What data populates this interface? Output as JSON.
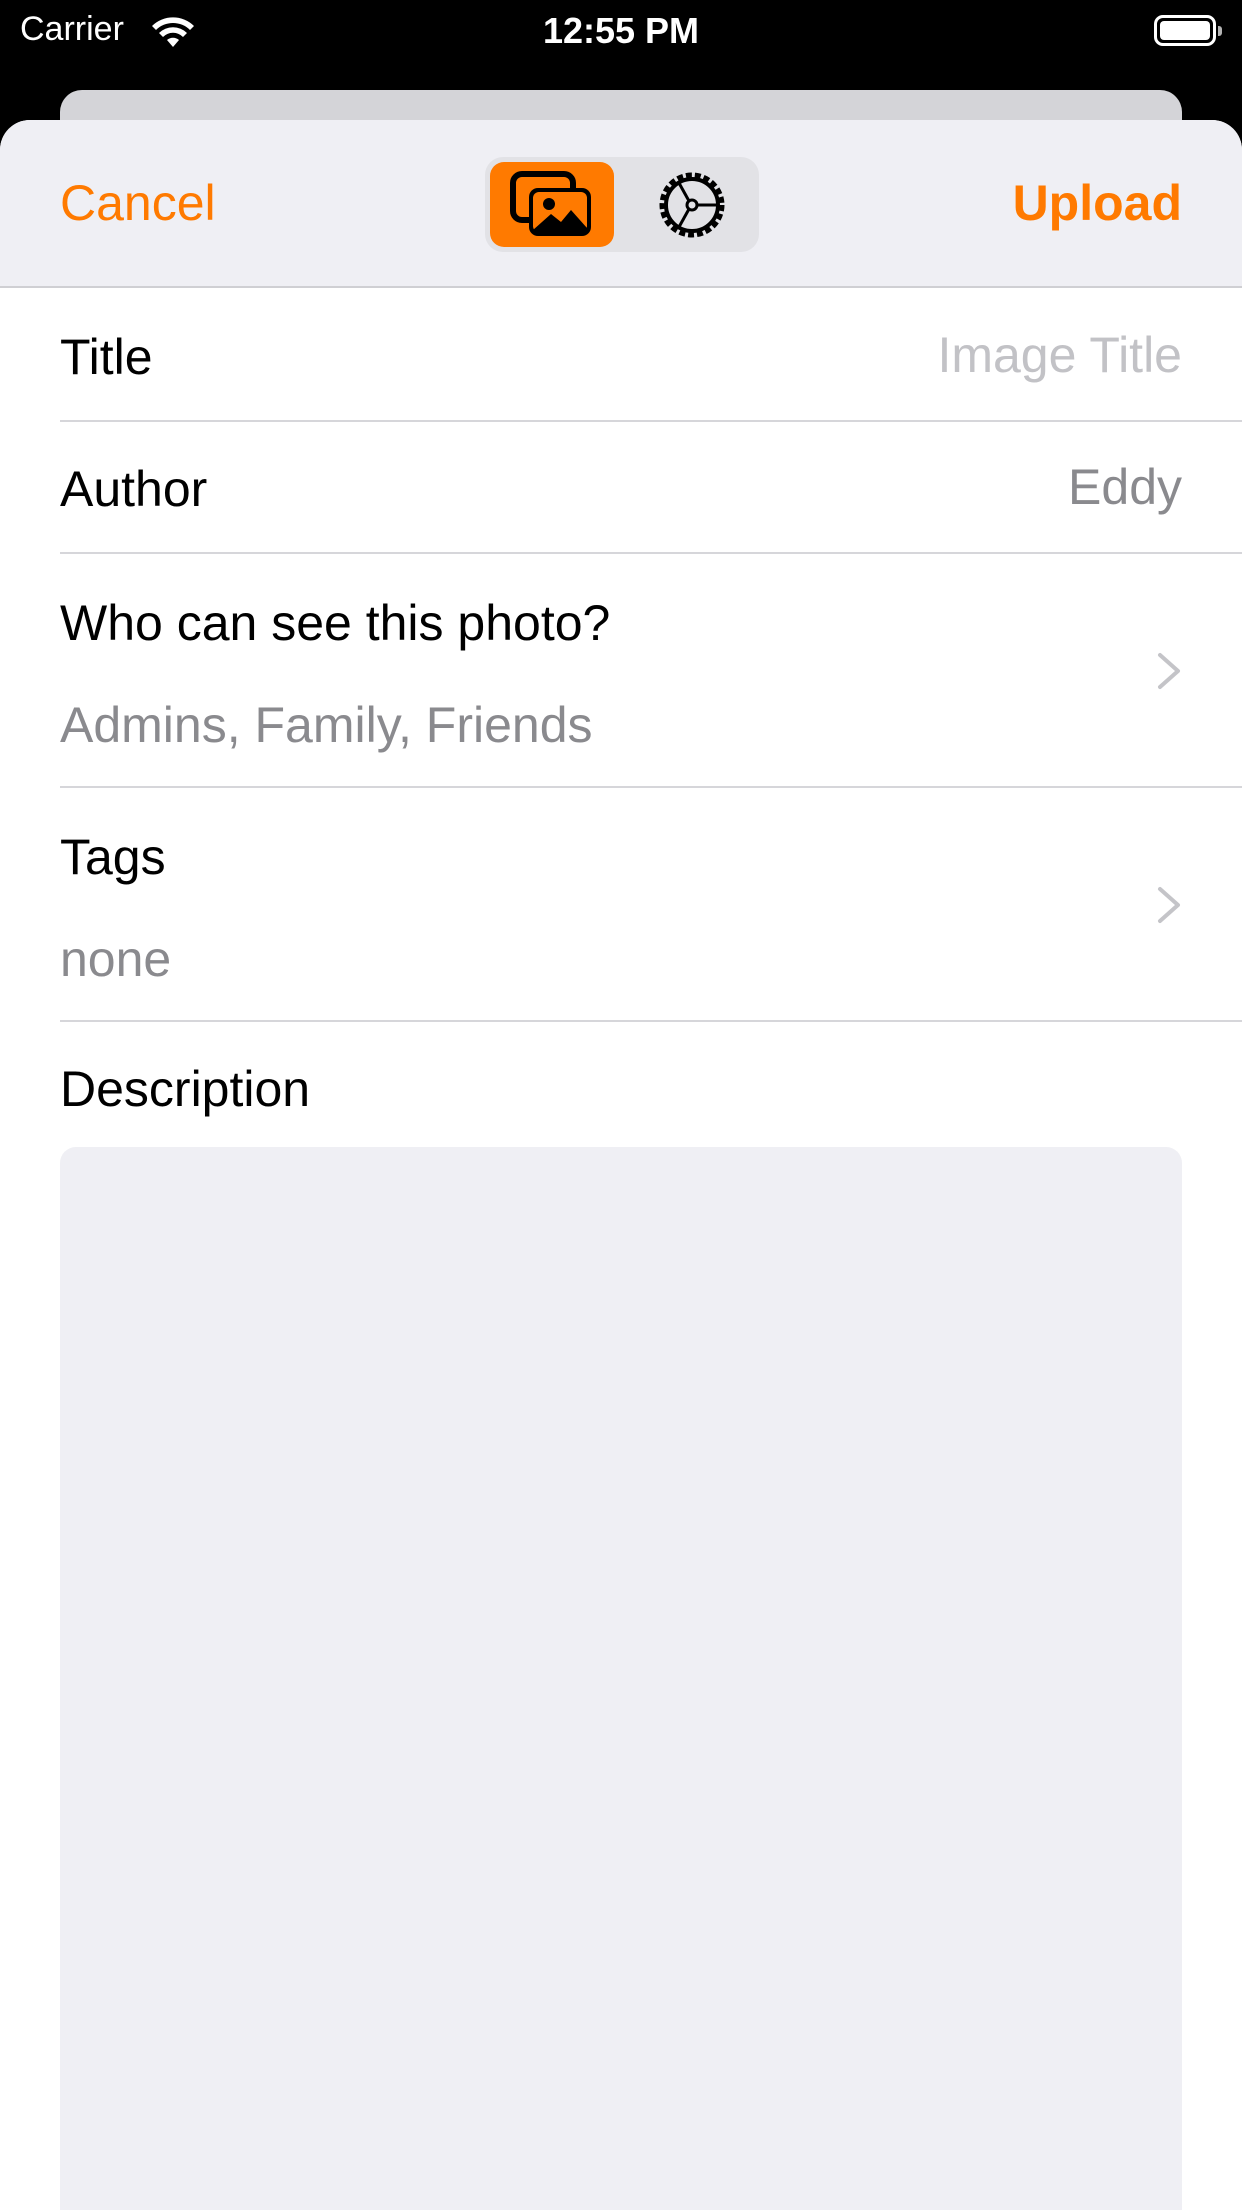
{
  "status_bar": {
    "carrier": "Carrier",
    "time": "12:55 PM",
    "wifi_icon": "wifi-icon",
    "battery_icon": "battery-full-icon"
  },
  "nav": {
    "cancel_label": "Cancel",
    "upload_label": "Upload",
    "segments": [
      {
        "icon": "photos-icon",
        "selected": true
      },
      {
        "icon": "settings-gear-icon",
        "selected": false
      }
    ]
  },
  "form": {
    "title": {
      "label": "Title",
      "placeholder": "Image Title",
      "value": ""
    },
    "author": {
      "label": "Author",
      "value": "Eddy"
    },
    "privacy": {
      "label": "Who can see this photo?",
      "value": "Admins, Family, Friends"
    },
    "tags": {
      "label": "Tags",
      "value": "none"
    },
    "description": {
      "label": "Description",
      "value": ""
    }
  },
  "colors": {
    "accent": "#ff7a00",
    "nav_background": "#efeff4",
    "secondary_text": "#8a8a8e",
    "placeholder_text": "#c2c2c6"
  }
}
